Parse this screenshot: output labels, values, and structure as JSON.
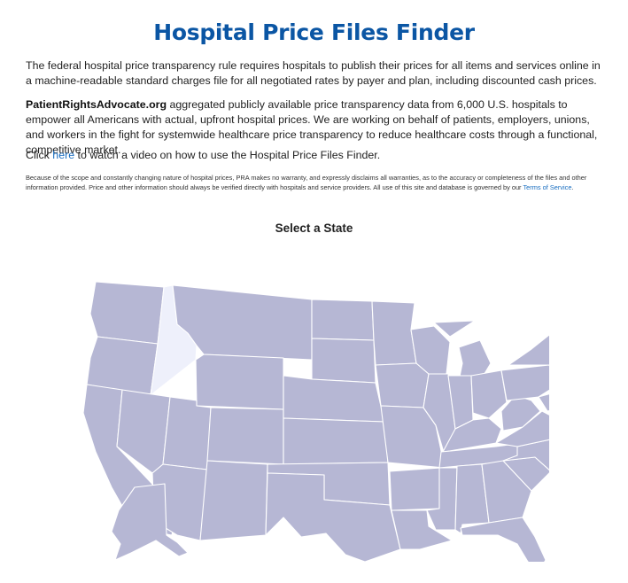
{
  "page": {
    "title": "Hospital Price Files Finder",
    "intro": "The federal hospital price transparency rule requires hospitals to publish their prices for all items and services online in a machine-readable standard charges file for all negotiated rates by payer and plan, including discounted cash prices.",
    "brand": "PatientRightsAdvocate.org",
    "mission": " aggregated publicly available price transparency data from 6,000 U.S. hospitals to empower all Americans with actual, upfront hospital prices. We are working on behalf of patients, employers, unions, and workers in the fight for systemwide healthcare price transparency to reduce healthcare costs through a functional, competitive market.",
    "video_prefix": "Click ",
    "video_link": "here",
    "video_suffix": " to watch a video on how to use the Hospital Price Files Finder.",
    "disclaimer": "Because of the scope and constantly changing nature of hospital prices, PRA makes no warranty, and expressly disclaims all warranties, as to the accuracy or completeness of the files and other information provided. Price and other information should always be verified directly with hospitals and service providers. All use of this site and database is governed by our ",
    "terms_link": "Terms of Service",
    "disclaimer_end": ".",
    "select_heading": "Select a State"
  },
  "map": {
    "highlighted_state": "Idaho",
    "state_color": "#b6b7d4",
    "highlight_color": "#eef0fb",
    "title_color": "#0b56a4",
    "link_color": "#1a6ec0"
  }
}
